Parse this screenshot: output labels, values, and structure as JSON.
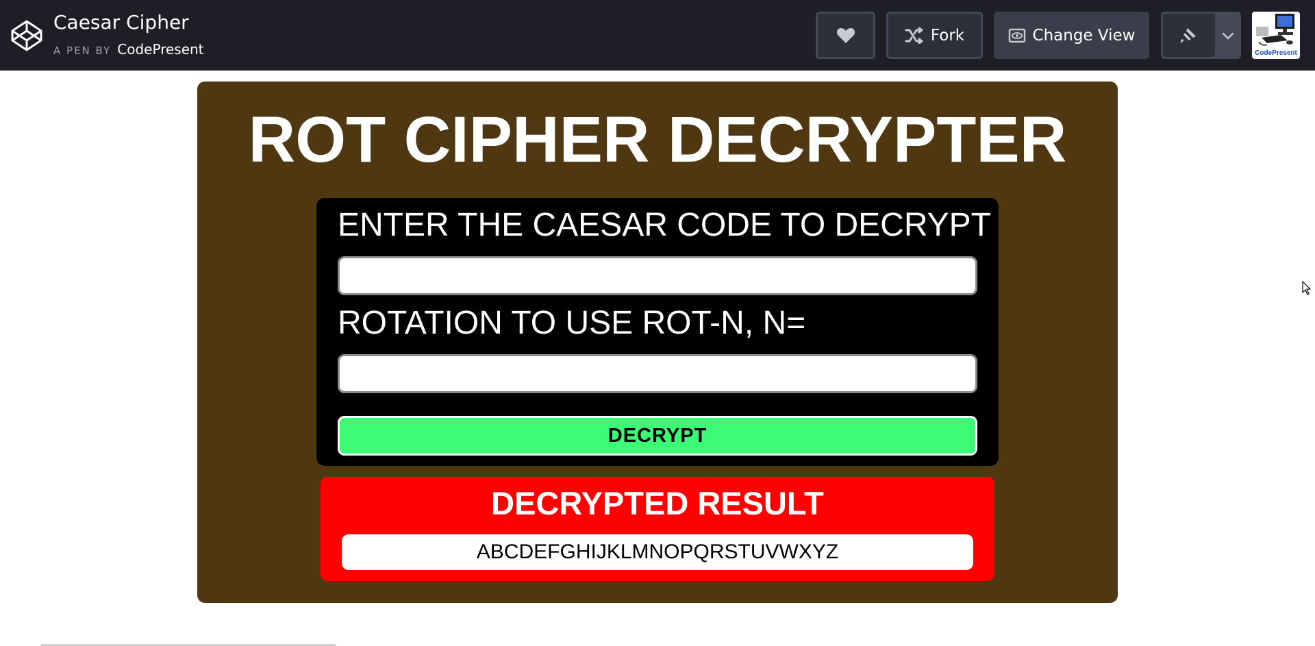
{
  "header": {
    "title": "Caesar Cipher",
    "byline_prefix": "A PEN BY",
    "author": "CodePresent",
    "fork_label": "Fork",
    "change_view_label": "Change View",
    "avatar_text": "CodePresent"
  },
  "app": {
    "title": "ROT CIPHER DECRYPTER",
    "code_label": "ENTER THE CAESAR CODE TO DECRYPT",
    "code_value": "",
    "rotation_label": "ROTATION TO USE ROT-N, N=",
    "rotation_value": "",
    "decrypt_label": "DECRYPT",
    "result_title": "DECRYPTED RESULT",
    "result_value": "ABCDEFGHIJKLMNOPQRSTUVWXYZ"
  },
  "icons": {
    "logo": "codepen-logo-icon",
    "heart": "heart-icon",
    "fork": "fork-icon",
    "change_view": "eye-icon",
    "pin": "pin-icon",
    "dropdown": "chevron-down-icon",
    "cursor": "mouse-cursor-icon"
  },
  "colors": {
    "header_bg": "#1e1f26",
    "button_bg": "#444857",
    "panel_bg": "#4e3711",
    "form_bg": "#000000",
    "decrypt_btn": "#3cfc75",
    "result_bg": "#ff0000"
  }
}
